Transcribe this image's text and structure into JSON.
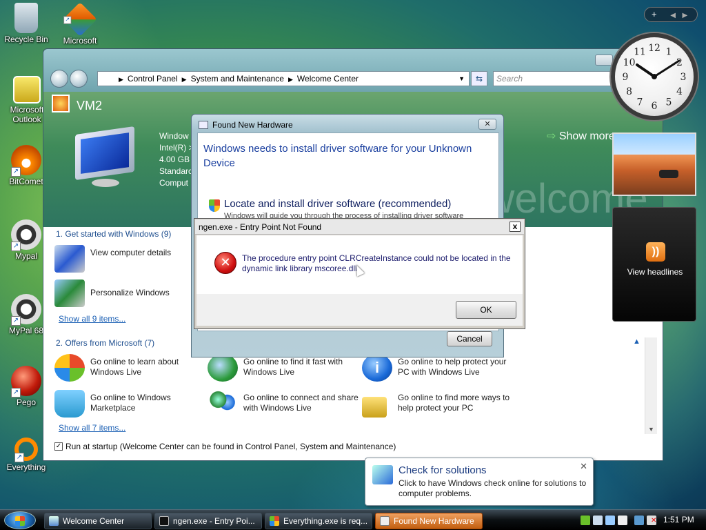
{
  "desktop": {
    "icons": [
      {
        "label": "Recycle Bin"
      },
      {
        "label": "Microsoft"
      },
      {
        "label": "Microsoft Outlook"
      },
      {
        "label": "BitComet"
      },
      {
        "label": "Mypal"
      },
      {
        "label": "MyPal 68"
      },
      {
        "label": "Pego"
      },
      {
        "label": "Everything"
      }
    ]
  },
  "welcome_center": {
    "breadcrumb": [
      "Control Panel",
      "System and Maintenance",
      "Welcome Center"
    ],
    "search_placeholder": "Search",
    "vm_name": "VM2",
    "sysinfo": [
      "Window",
      "Intel(R) >",
      "4.00 GB I",
      "Standarc",
      "Comput"
    ],
    "show_more": "Show more",
    "watermark": "welcome",
    "section1_title": "1. Get started with Windows (9)",
    "section1_tasks": [
      "View computer details",
      "Personalize Windows"
    ],
    "section1_link": "Show all 9 items...",
    "section2_title": "2. Offers from Microsoft (7)",
    "section2_tasks": [
      "Go online to learn about Windows Live",
      "Go online to find it fast with Windows Live",
      "Go online to help protect your PC with Windows Live",
      "Go online to Windows Marketplace",
      "Go online to connect and share with Windows Live",
      "Go online to find more ways to help protect your PC"
    ],
    "section2_link": "Show all 7 items...",
    "startup_label": "Run at startup (Welcome Center can be found in Control Panel, System and Maintenance)"
  },
  "found_new_hardware": {
    "title": "Found New Hardware",
    "heading": "Windows needs to install driver software for your Unknown Device",
    "option": "Locate and install driver software (recommended)",
    "option_sub": "Windows will guide you through the process of installing driver software",
    "cancel_label": "Cancel"
  },
  "error_dialog": {
    "title": "ngen.exe - Entry Point Not Found",
    "message": "The procedure entry point CLRCreateInstance could not be located in the dynamic link library mscoree.dll.",
    "ok_label": "OK",
    "close_label": "x"
  },
  "gadgets": {
    "feeds_label": "View headlines",
    "clock_numbers": [
      "12",
      "1",
      "2",
      "3",
      "4",
      "5",
      "6",
      "7",
      "8",
      "9",
      "10",
      "11"
    ]
  },
  "balloon": {
    "title": "Check for solutions",
    "body": "Click to have Windows check online for solutions to computer problems."
  },
  "taskbar": {
    "buttons": [
      {
        "label": "Welcome Center",
        "active": false
      },
      {
        "label": "ngen.exe - Entry Poi...",
        "active": false
      },
      {
        "label": "Everything.exe is req...",
        "active": false
      },
      {
        "label": "Found New Hardware",
        "active": true
      }
    ],
    "time": "1:51 PM"
  },
  "colors": {
    "accent_link": "#1a5fb4",
    "active_task": "#c25e10"
  }
}
